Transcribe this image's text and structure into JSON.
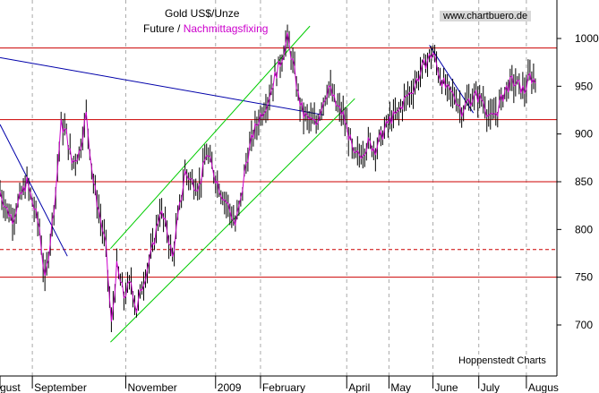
{
  "header": {
    "title": "Gold US$/Unze",
    "series_future": "Future",
    "separator": "/",
    "series_fixing": "Nachmittagsfixing",
    "watermark": "www.chartbuero.de",
    "footer": "Hoppenstedt Charts"
  },
  "colors": {
    "price_bars": "#000000",
    "fixing_line": "#cc00cc",
    "support_lines": "#cc0000",
    "channel_lines": "#00cc00",
    "trend_lines": "#0000aa",
    "grid": "#aaaaaa"
  },
  "chart_data": {
    "type": "line",
    "title": "Gold US$/Unze",
    "subtitle": "Future / Nachmittagsfixing",
    "ylim": [
      645,
      1030
    ],
    "yticks": [
      700,
      750,
      800,
      850,
      900,
      950,
      1000
    ],
    "x_tick_labels": [
      "gust",
      "September",
      "November",
      "2009",
      "February",
      "April",
      "May",
      "June",
      "July",
      "Augus"
    ],
    "x_tick_index": [
      0,
      36,
      140,
      240,
      290,
      386,
      433,
      482,
      533,
      586
    ],
    "horizontal_lines": [
      {
        "value": 990,
        "style": "solid"
      },
      {
        "value": 915,
        "style": "solid"
      },
      {
        "value": 850,
        "style": "solid"
      },
      {
        "value": 779,
        "style": "dashed"
      },
      {
        "value": 750,
        "style": "solid"
      }
    ],
    "trendlines": [
      {
        "kind": "trend",
        "from": [
          0,
          980
        ],
        "to": [
          360,
          920
        ]
      },
      {
        "kind": "trend",
        "from": [
          0,
          910
        ],
        "to": [
          75,
          772
        ]
      },
      {
        "kind": "trend",
        "from": [
          478,
          993
        ],
        "to": [
          527,
          922
        ]
      },
      {
        "kind": "channel",
        "from": [
          123,
          682
        ],
        "to": [
          395,
          937
        ]
      },
      {
        "kind": "channel",
        "from": [
          123,
          780
        ],
        "to": [
          345,
          1013
        ]
      }
    ],
    "price_path": [
      [
        0,
        840
      ],
      [
        8,
        820
      ],
      [
        14,
        812
      ],
      [
        22,
        832
      ],
      [
        30,
        850
      ],
      [
        38,
        822
      ],
      [
        44,
        802
      ],
      [
        50,
        745
      ],
      [
        56,
        790
      ],
      [
        62,
        840
      ],
      [
        68,
        910
      ],
      [
        74,
        900
      ],
      [
        80,
        870
      ],
      [
        88,
        880
      ],
      [
        96,
        920
      ],
      [
        104,
        850
      ],
      [
        112,
        810
      ],
      [
        118,
        780
      ],
      [
        124,
        700
      ],
      [
        130,
        760
      ],
      [
        138,
        730
      ],
      [
        146,
        745
      ],
      [
        152,
        715
      ],
      [
        158,
        740
      ],
      [
        164,
        760
      ],
      [
        170,
        780
      ],
      [
        178,
        820
      ],
      [
        186,
        800
      ],
      [
        192,
        770
      ],
      [
        198,
        810
      ],
      [
        206,
        860
      ],
      [
        214,
        850
      ],
      [
        222,
        845
      ],
      [
        230,
        880
      ],
      [
        238,
        860
      ],
      [
        246,
        840
      ],
      [
        254,
        825
      ],
      [
        262,
        805
      ],
      [
        268,
        830
      ],
      [
        274,
        870
      ],
      [
        282,
        900
      ],
      [
        290,
        920
      ],
      [
        298,
        935
      ],
      [
        306,
        960
      ],
      [
        312,
        975
      ],
      [
        320,
        1000
      ],
      [
        326,
        975
      ],
      [
        332,
        940
      ],
      [
        338,
        920
      ],
      [
        344,
        915
      ],
      [
        352,
        910
      ],
      [
        358,
        930
      ],
      [
        366,
        950
      ],
      [
        374,
        930
      ],
      [
        382,
        920
      ],
      [
        388,
        900
      ],
      [
        394,
        875
      ],
      [
        402,
        880
      ],
      [
        410,
        890
      ],
      [
        418,
        885
      ],
      [
        426,
        900
      ],
      [
        434,
        915
      ],
      [
        442,
        920
      ],
      [
        450,
        935
      ],
      [
        458,
        945
      ],
      [
        466,
        960
      ],
      [
        474,
        975
      ],
      [
        482,
        985
      ],
      [
        490,
        960
      ],
      [
        498,
        945
      ],
      [
        506,
        940
      ],
      [
        514,
        925
      ],
      [
        522,
        935
      ],
      [
        530,
        940
      ],
      [
        538,
        935
      ],
      [
        546,
        915
      ],
      [
        554,
        925
      ],
      [
        562,
        945
      ],
      [
        570,
        955
      ],
      [
        578,
        950
      ],
      [
        584,
        945
      ],
      [
        590,
        960
      ],
      [
        596,
        955
      ]
    ]
  }
}
